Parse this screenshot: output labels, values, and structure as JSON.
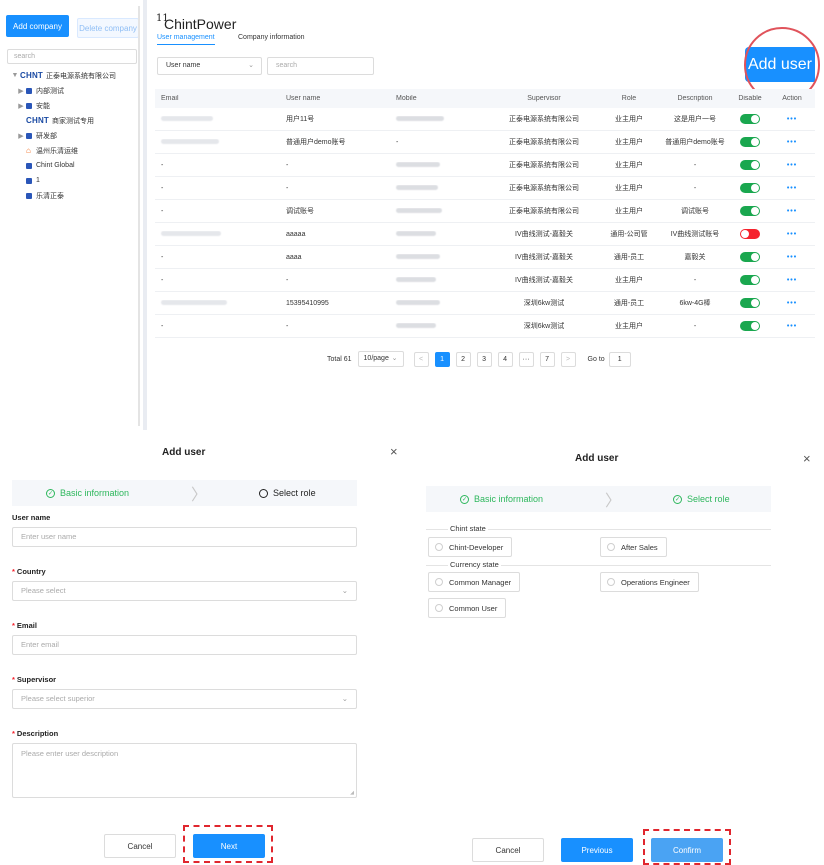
{
  "sidebar": {
    "add_company": "Add company",
    "delete_company": "Delete company",
    "search_placeholder": "search",
    "tree": [
      {
        "arrow": "▼",
        "kind": "brand",
        "brand": "CHNT",
        "label": "正泰电源系统有限公司",
        "indent": 0
      },
      {
        "arrow": "▶",
        "kind": "folder",
        "label": "内部测试",
        "indent": 1
      },
      {
        "arrow": "▶",
        "kind": "folder",
        "label": "安能",
        "indent": 1
      },
      {
        "arrow": "",
        "kind": "brand",
        "brand": "CHNT",
        "label": "商家测试专用",
        "indent": 1
      },
      {
        "arrow": "▶",
        "kind": "folder",
        "label": "研发部",
        "indent": 1
      },
      {
        "arrow": "",
        "kind": "home",
        "label": "温州乐清运维",
        "indent": 1
      },
      {
        "arrow": "",
        "kind": "folder",
        "label": "Chint Global",
        "indent": 1
      },
      {
        "arrow": "",
        "kind": "folder",
        "label": "1",
        "indent": 1
      },
      {
        "arrow": "",
        "kind": "folder",
        "label": "乐清正泰",
        "indent": 1
      }
    ]
  },
  "header": {
    "logo_mark": "11",
    "brand": "ChintPower",
    "tab_active": "User management",
    "tab_other": "Company information",
    "filter_select": "User name",
    "filter_search_placeholder": "search",
    "add_user": "Add user"
  },
  "table": {
    "columns": {
      "email": "Email",
      "name": "User name",
      "mobile": "Mobile",
      "supervisor": "Supervisor",
      "role": "Role",
      "description": "Description",
      "disable": "Disable",
      "action": "Action"
    },
    "action_glyph": "•••",
    "rows": [
      {
        "email": "",
        "name": "用户11号",
        "mobile": "",
        "supervisor": "正泰电源系统有限公司",
        "role": "业主用户",
        "description": "这是用户一号",
        "enabled": true,
        "blur": [
          52,
          48
        ]
      },
      {
        "email": "",
        "name": "普通用户demo账号",
        "mobile": "-",
        "supervisor": "正泰电源系统有限公司",
        "role": "业主用户",
        "description": "普通用户demo账号",
        "enabled": true,
        "blur": [
          58,
          0
        ]
      },
      {
        "email": "-",
        "name": "-",
        "mobile": "",
        "supervisor": "正泰电源系统有限公司",
        "role": "业主用户",
        "description": "-",
        "enabled": true,
        "blur": [
          0,
          44
        ]
      },
      {
        "email": "-",
        "name": "-",
        "mobile": "",
        "supervisor": "正泰电源系统有限公司",
        "role": "业主用户",
        "description": "-",
        "enabled": true,
        "blur": [
          0,
          42
        ]
      },
      {
        "email": "-",
        "name": "调试账号",
        "mobile": "",
        "supervisor": "正泰电源系统有限公司",
        "role": "业主用户",
        "description": "调试账号",
        "enabled": true,
        "blur": [
          0,
          46
        ]
      },
      {
        "email": "",
        "name": "aaaaa",
        "mobile": "",
        "supervisor": "IV曲线测试-嘉毅关",
        "role": "通用-公司管",
        "description": "IV曲线测试账号",
        "enabled": false,
        "blur": [
          60,
          40
        ]
      },
      {
        "email": "-",
        "name": "aaaa",
        "mobile": "",
        "supervisor": "IV曲线测试-嘉毅关",
        "role": "通用-员工",
        "description": "嘉毅关",
        "enabled": true,
        "blur": [
          0,
          44
        ]
      },
      {
        "email": "-",
        "name": "-",
        "mobile": "",
        "supervisor": "IV曲线测试-嘉毅关",
        "role": "业主用户",
        "description": "-",
        "enabled": true,
        "blur": [
          0,
          40
        ]
      },
      {
        "email": "",
        "name": "15395410995",
        "mobile": "",
        "supervisor": "深圳6kw测试",
        "role": "通用-员工",
        "description": "6kw-4G棒",
        "enabled": true,
        "blur": [
          66,
          44
        ]
      },
      {
        "email": "-",
        "name": "-",
        "mobile": "",
        "supervisor": "深圳6kw测试",
        "role": "业主用户",
        "description": "-",
        "enabled": true,
        "blur": [
          0,
          40
        ]
      }
    ]
  },
  "pagination": {
    "total": "Total 61",
    "page_size": "10/page",
    "prev": "<",
    "pages": [
      "1",
      "2",
      "3",
      "4",
      "···",
      "7"
    ],
    "active_page": "1",
    "next": ">",
    "goto_label": "Go to",
    "goto_value": "1"
  },
  "dialog_basic": {
    "title": "Add user",
    "close": "×",
    "step1": "Basic information",
    "step2": "Select role",
    "fields": [
      {
        "label": "User name",
        "required": false,
        "placeholder": "Enter user name",
        "type": "input"
      },
      {
        "label": "Country",
        "required": true,
        "placeholder": "Please select",
        "type": "select"
      },
      {
        "label": "Email",
        "required": true,
        "placeholder": "Enter email",
        "type": "input"
      },
      {
        "label": "Supervisor",
        "required": true,
        "placeholder": "Please select superior",
        "type": "select"
      },
      {
        "label": "Description",
        "required": true,
        "placeholder": "Please enter user description",
        "type": "textarea"
      }
    ],
    "cancel": "Cancel",
    "next": "Next"
  },
  "dialog_role": {
    "title": "Add user",
    "close": "×",
    "step1": "Basic information",
    "step2": "Select role",
    "group1_label": "Chint state",
    "group1_options": [
      "Chint-Developer",
      "After Sales"
    ],
    "group2_label": "Currency state",
    "group2_options": [
      "Common Manager",
      "Operations Engineer",
      "Common User"
    ],
    "cancel": "Cancel",
    "previous": "Previous",
    "confirm": "Confirm"
  },
  "colors": {
    "primary": "#1890ff",
    "success": "#2db75c",
    "toggle_on": "#1aa74f",
    "toggle_off": "#f5222d",
    "highlight_red": "#e0262e"
  }
}
